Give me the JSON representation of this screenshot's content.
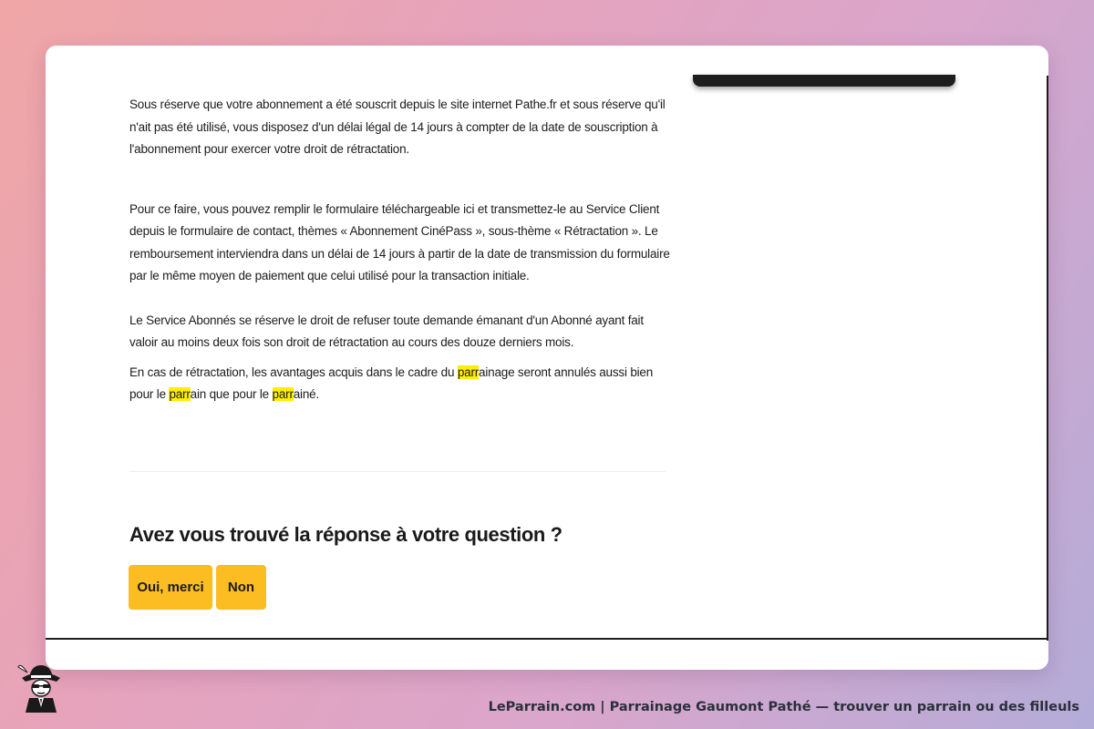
{
  "article": {
    "p1": "Sous réserve que votre abonnement a été souscrit depuis le site internet Pathe.fr et sous réserve qu'il n'ait pas été utilisé, vous disposez d'un délai légal de 14 jours à compter de la date de souscription à l'abonnement pour exercer votre droit de rétractation.",
    "p2": "Pour ce faire, vous pouvez remplir le formulaire téléchargeable ici et transmettez-le au Service Client depuis le formulaire de contact, thèmes « Abonnement CinéPass », sous-thème « Rétractation ». Le remboursement interviendra dans un délai de 14 jours à partir de la date de transmission du formulaire par le même moyen de paiement que celui utilisé pour la transaction initiale.",
    "p3": "Le Service Abonnés se réserve le droit de refuser toute demande émanant d'un Abonné ayant fait valoir au moins deux fois son droit de rétractation au cours des douze derniers mois.",
    "p4": {
      "a": "En cas de rétractation, les avantages acquis dans le cadre du ",
      "h1": "parr",
      "b": "ainage seront annulés aussi bien pour le ",
      "h2": "parr",
      "c": "ain que pour le ",
      "h3": "parr",
      "d": "ainé."
    }
  },
  "feedback": {
    "question": "Avez vous trouvé la réponse à votre question ?",
    "yes_label": "Oui, merci",
    "no_label": "Non"
  },
  "footer": {
    "caption": "LeParrain.com | Parrainage Gaumont Pathé — trouver un parrain ou des filleuls"
  },
  "icons": {
    "mascot": "detective-mascot-icon"
  },
  "colors": {
    "button_bg": "#fbbd22",
    "highlight": "#ffee00",
    "text": "#1c1c1c"
  }
}
